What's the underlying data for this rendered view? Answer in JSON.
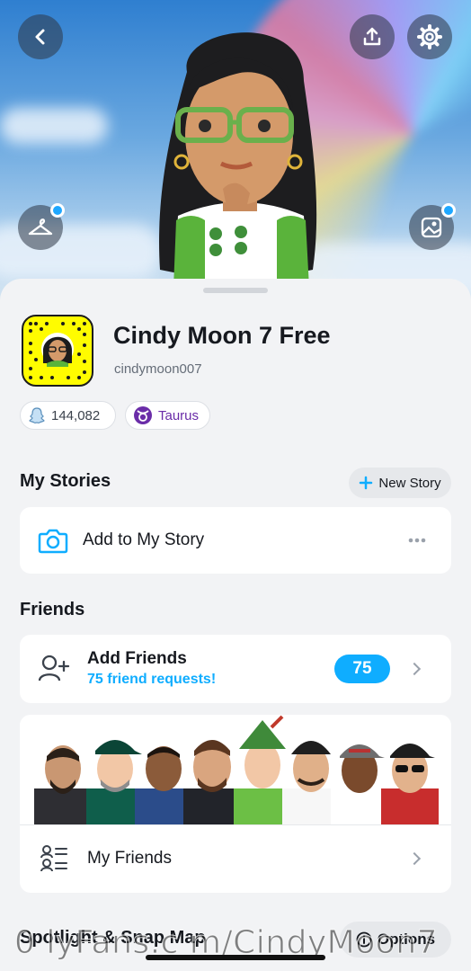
{
  "profile": {
    "display_name": "Cindy Moon 7 Free",
    "username": "cindymoon007",
    "snap_score": "144,082",
    "zodiac": "Taurus"
  },
  "my_stories": {
    "title": "My Stories",
    "new_story_label": "New Story",
    "add_label": "Add to My Story"
  },
  "friends": {
    "title": "Friends",
    "add_friends_label": "Add Friends",
    "requests_text": "75 friend requests!",
    "requests_count": "75",
    "my_friends_label": "My Friends"
  },
  "spotlight": {
    "title": "Spotlight & Snap Map",
    "options_label": "Options"
  },
  "watermark": "0 lyFans.c m/CindyMoon7",
  "colors": {
    "accent_blue": "#0fadff",
    "snap_yellow": "#fffc00",
    "zodiac_purple": "#6a2ca8"
  },
  "icons": [
    "back-icon",
    "share-icon",
    "settings-icon",
    "hanger-icon",
    "gallery-icon",
    "snapcode-icon",
    "snap-score-icon",
    "taurus-icon",
    "plus-icon",
    "camera-icon",
    "more-icon",
    "add-friend-icon",
    "chevron-right-icon",
    "friends-list-icon",
    "info-icon"
  ]
}
